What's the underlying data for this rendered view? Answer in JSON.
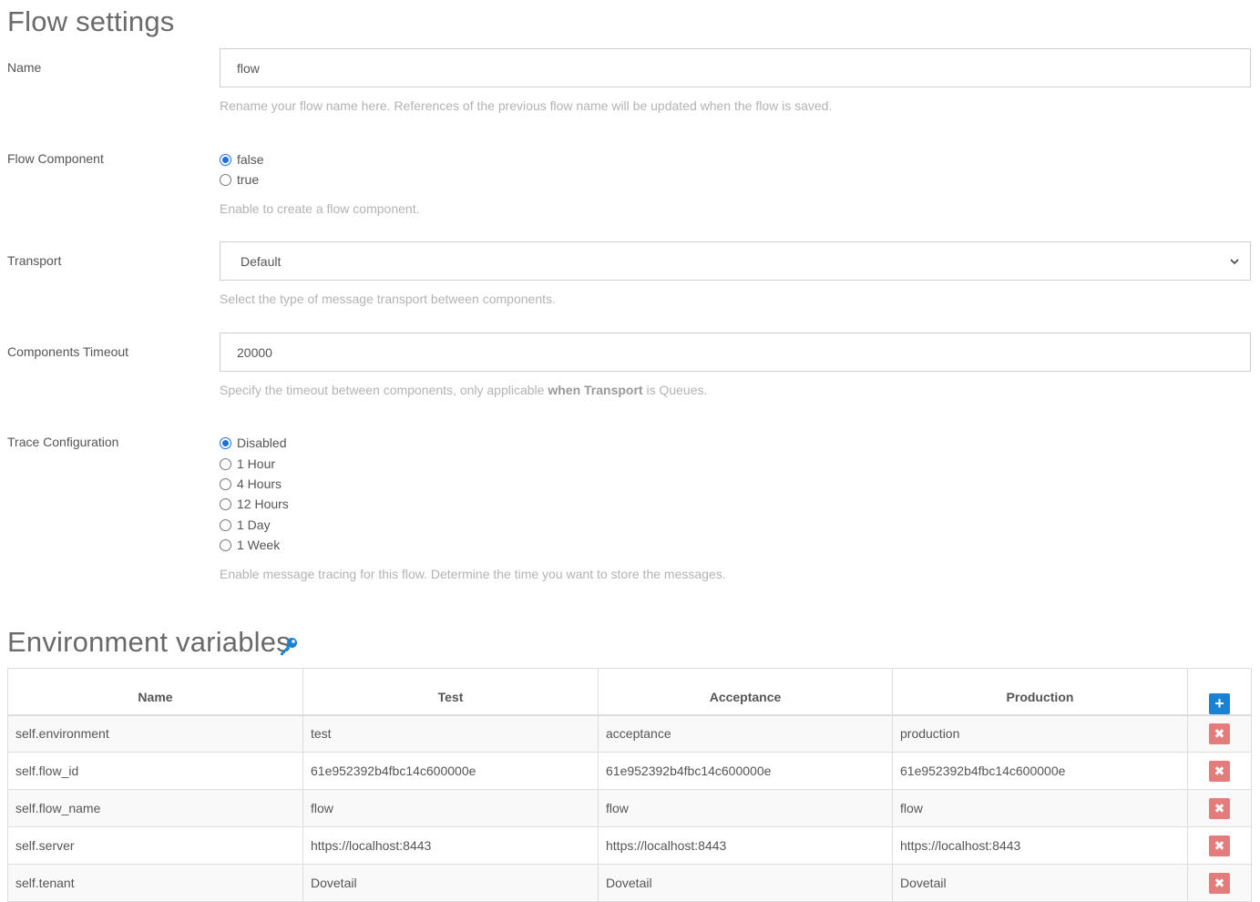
{
  "flow_settings": {
    "title": "Flow settings",
    "name": {
      "label": "Name",
      "value": "flow",
      "help": "Rename your flow name here. References of the previous flow name will be updated when the flow is saved."
    },
    "flow_component": {
      "label": "Flow Component",
      "options": [
        {
          "label": "false",
          "checked": true
        },
        {
          "label": "true",
          "checked": false
        }
      ],
      "help": "Enable to create a flow component."
    },
    "transport": {
      "label": "Transport",
      "selected": "Default",
      "help": "Select the type of message transport between components."
    },
    "components_timeout": {
      "label": "Components Timeout",
      "value": "20000",
      "help_prefix": "Specify the timeout between components, only applicable ",
      "help_bold": "when Transport",
      "help_suffix": " is Queues."
    },
    "trace_configuration": {
      "label": "Trace Configuration",
      "options": [
        {
          "label": "Disabled",
          "checked": true
        },
        {
          "label": "1 Hour",
          "checked": false
        },
        {
          "label": "4 Hours",
          "checked": false
        },
        {
          "label": "12 Hours",
          "checked": false
        },
        {
          "label": "1 Day",
          "checked": false
        },
        {
          "label": "1 Week",
          "checked": false
        }
      ],
      "help": "Enable message tracing for this flow. Determine the time you want to store the messages."
    }
  },
  "environment_variables": {
    "title": "Environment variables",
    "icon": "key-icon",
    "columns": [
      "Name",
      "Test",
      "Acceptance",
      "Production"
    ],
    "add_icon": "plus-icon",
    "delete_icon": "times-icon",
    "rows": [
      [
        "self.environment",
        "test",
        "acceptance",
        "production"
      ],
      [
        "self.flow_id",
        "61e952392b4fbc14c600000e",
        "61e952392b4fbc14c600000e",
        "61e952392b4fbc14c600000e"
      ],
      [
        "self.flow_name",
        "flow",
        "flow",
        "flow"
      ],
      [
        "self.server",
        "https://localhost:8443",
        "https://localhost:8443",
        "https://localhost:8443"
      ],
      [
        "self.tenant",
        "Dovetail",
        "Dovetail",
        "Dovetail"
      ]
    ]
  },
  "colors": {
    "accent": "#1a82d2",
    "radio": "#1e6fd9",
    "delete": "#e57c7c"
  }
}
